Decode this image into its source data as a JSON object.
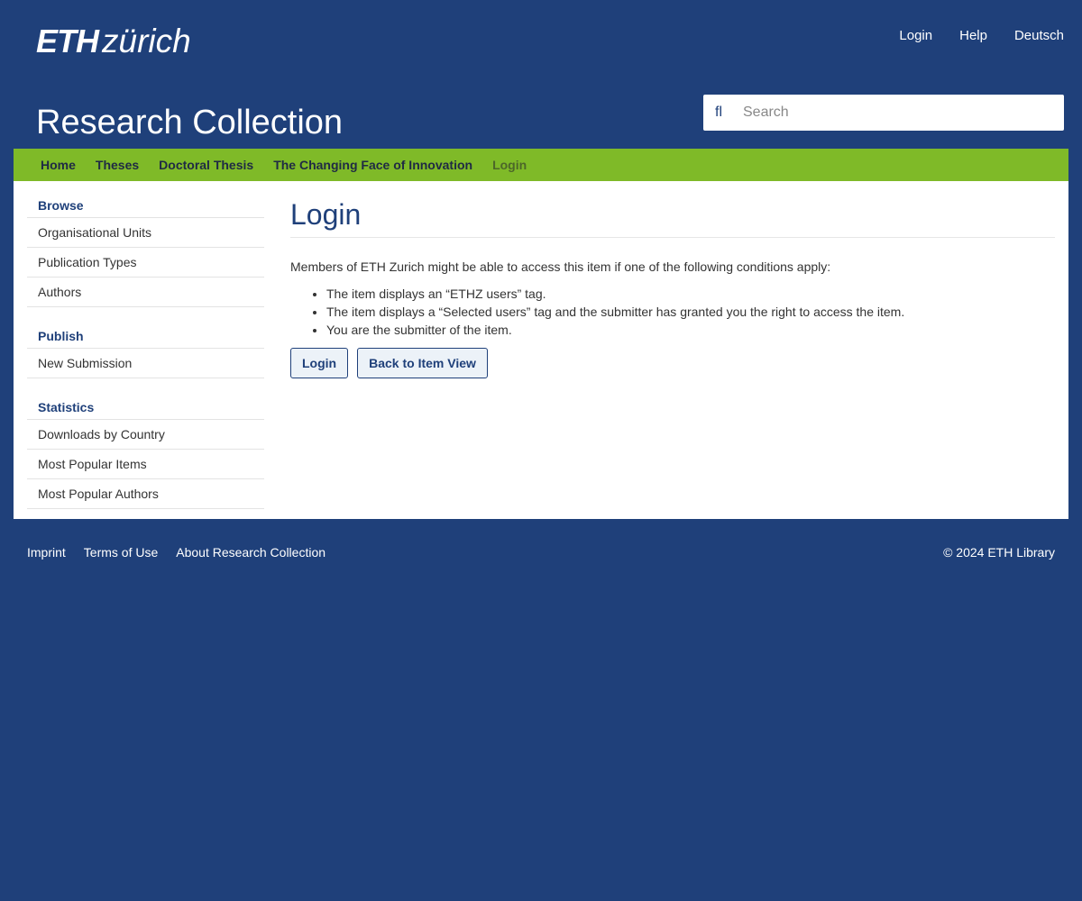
{
  "header": {
    "logo": {
      "eth": "ETH",
      "zurich": "zürich"
    },
    "nav": [
      "Login",
      "Help",
      "Deutsch"
    ],
    "site_title": "Research Collection",
    "search": {
      "icon_glyph": "fl",
      "placeholder": "Search",
      "value": ""
    }
  },
  "breadcrumb": {
    "items": [
      "Home",
      "Theses",
      "Doctoral Thesis",
      "The Changing Face of Innovation"
    ],
    "current": "Login",
    "separator_glyph": ""
  },
  "sidebar": {
    "browse": {
      "heading": "Browse",
      "items": [
        "Organisational Units",
        "Publication Types",
        "Authors"
      ]
    },
    "publish": {
      "heading": "Publish",
      "items": [
        "New Submission"
      ]
    },
    "statistics": {
      "heading": "Statistics",
      "items": [
        "Downloads by Country",
        "Most Popular Items",
        "Most Popular Authors"
      ]
    }
  },
  "main": {
    "title": "Login",
    "intro": "Members of ETH Zurich might be able to access this item if one of the following conditions apply:",
    "conditions": [
      "The item displays an “ETHZ users” tag.",
      "The item displays a “Selected users” tag and the submitter has granted you the right to access the item.",
      "You are the submitter of the item."
    ],
    "buttons": {
      "login": "Login",
      "back": "Back to Item View"
    }
  },
  "footer": {
    "links": [
      "Imprint",
      "Terms of Use",
      "About Research Collection"
    ],
    "copyright": "© 2024 ETH Library"
  },
  "colors": {
    "brand_blue": "#1f407a",
    "breadcrumb_green": "#7fba28"
  }
}
